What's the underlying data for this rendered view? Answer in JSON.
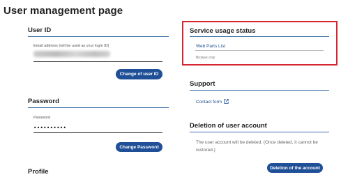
{
  "page": {
    "title": "User management page"
  },
  "user_id": {
    "heading": "User ID",
    "field_label": "Email address (will be used as your login ID)",
    "button_label": "Change of user ID"
  },
  "password": {
    "heading": "Password",
    "field_label": "Password",
    "value": "••••••••••",
    "button_label": "Change Password"
  },
  "profile": {
    "heading": "Profile"
  },
  "service_usage": {
    "heading": "Service usage status",
    "link_label": "Web Parts List",
    "note": "Browse only"
  },
  "support": {
    "heading": "Support",
    "link_label": "Contact form",
    "link_icon": "external-link-icon"
  },
  "deletion": {
    "heading": "Deletion of user account",
    "description": "The user account will be deleted. (Once deleted, it cannot be restored.)",
    "button_label": "Deletion of the account"
  },
  "colors": {
    "accent": "#1f4f96",
    "rule": "#3a6fa8",
    "highlight": "#d42630"
  }
}
